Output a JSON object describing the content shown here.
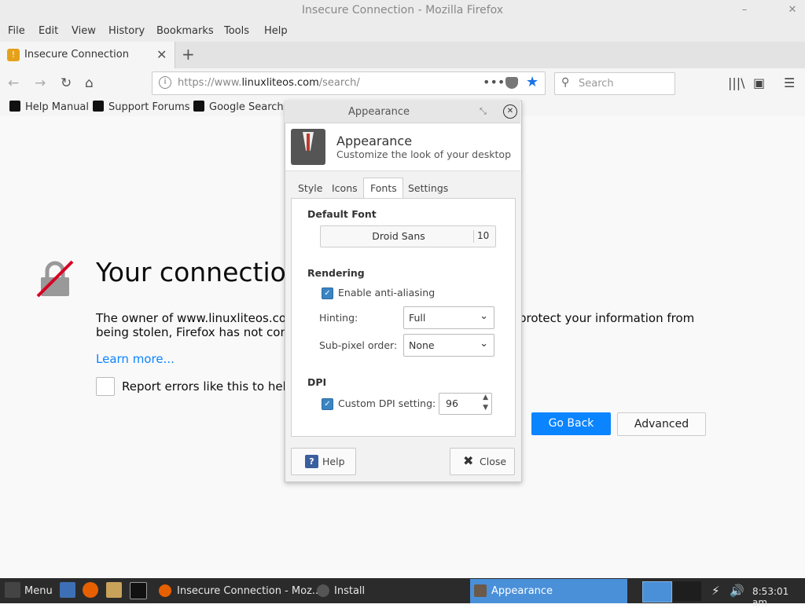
{
  "window": {
    "title": "Insecure Connection - Mozilla Firefox",
    "min_glyph": "–",
    "close_glyph": "✕"
  },
  "menubar": [
    "File",
    "Edit",
    "View",
    "History",
    "Bookmarks",
    "Tools",
    "Help"
  ],
  "tab": {
    "label": "Insecure Connection",
    "close": "✕",
    "new": "+"
  },
  "nav": {
    "back": "←",
    "forward": "→",
    "reload": "↻",
    "home": "⌂"
  },
  "url": {
    "prefix": "https://www.",
    "domain": "linuxliteos.com",
    "path": "/search/",
    "more": "•••",
    "star": "★"
  },
  "search": {
    "placeholder": "Search",
    "icon": "search-icon"
  },
  "toolbar_icons": {
    "library": "|||\\",
    "sidebar": "▣",
    "menu": "☰"
  },
  "bookmarks": [
    "Help Manual",
    "Support Forums",
    "Google Search"
  ],
  "page": {
    "title": "Your connection",
    "text1": "The owner of www.linuxliteos.com",
    "text1b": "protect your information from",
    "text2": "being stolen, Firefox has not conne",
    "learn_more": "Learn more...",
    "report_label": "Report errors like this to help I",
    "go_back": "Go Back",
    "advanced": "Advanced"
  },
  "dialog": {
    "window_title": "Appearance",
    "restore_glyph": "⤡",
    "close_glyph": "✕",
    "header_title": "Appearance",
    "header_subtitle": "Customize the look of your desktop",
    "tabs": [
      "Style",
      "Icons",
      "Fonts",
      "Settings"
    ],
    "selected_tab": "Fonts",
    "default_font_heading": "Default Font",
    "font_name": "Droid Sans",
    "font_size": "10",
    "rendering_heading": "Rendering",
    "antialias_label": "Enable anti-aliasing",
    "antialias_checked": true,
    "hinting_label": "Hinting:",
    "hinting_value": "Full",
    "subpixel_label": "Sub-pixel order:",
    "subpixel_value": "None",
    "dpi_heading": "DPI",
    "custom_dpi_label": "Custom DPI setting:",
    "custom_dpi_checked": true,
    "dpi_value": "96",
    "help_button": "Help",
    "help_glyph": "?",
    "close_button": "Close",
    "check_glyph": "✓",
    "chevron_glyph": "⌄"
  },
  "taskbar": {
    "menu_label": "Menu",
    "item_firefox": "Insecure Connection - Moz...",
    "item_install": "Install",
    "item_appearance": "Appearance",
    "clock": "8:53:01 am"
  },
  "colors": {
    "accent": "#0a84ff",
    "taskbar_active": "#4a90d9",
    "checkbox": "#3b84c4"
  }
}
